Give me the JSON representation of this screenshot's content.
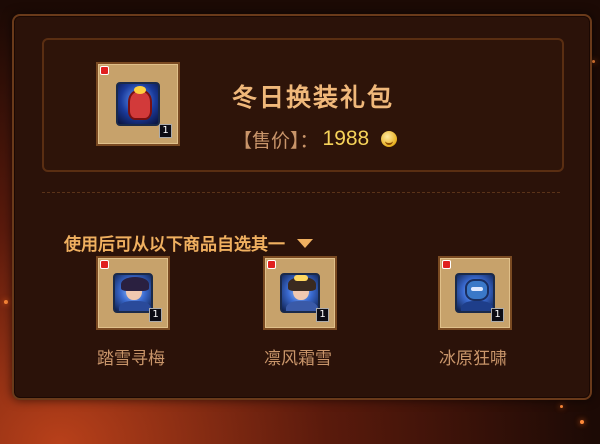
{
  "pack": {
    "title": "冬日换装礼包",
    "price_label": "【售价】：",
    "price_value": "1988",
    "currency_icon": "smiley-coin-icon",
    "item_count": "1"
  },
  "choice_hint": "使用后可从以下商品自选其一",
  "rewards": [
    {
      "name": "踏雪寻梅",
      "count": "1"
    },
    {
      "name": "凛风霜雪",
      "count": "1"
    },
    {
      "name": "冰原狂啸",
      "count": "1"
    }
  ],
  "colors": {
    "title": "#f0b87a",
    "price": "#f6d35a",
    "hint": "#f0b060",
    "label": "#c9956a"
  }
}
